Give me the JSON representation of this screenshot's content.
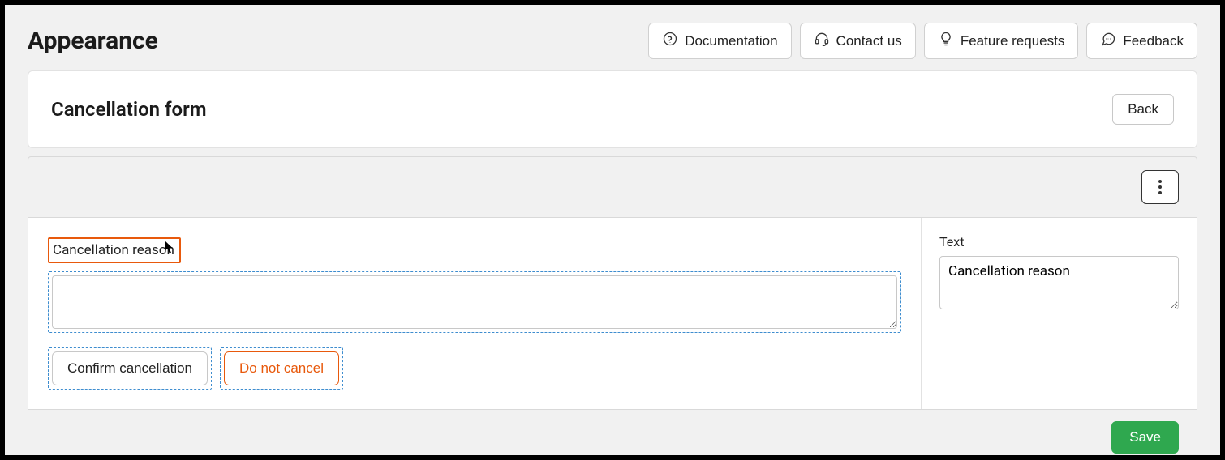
{
  "page": {
    "title": "Appearance"
  },
  "topbar": {
    "documentation": "Documentation",
    "contact": "Contact us",
    "feature_requests": "Feature requests",
    "feedback": "Feedback"
  },
  "panel": {
    "title": "Cancellation form",
    "back": "Back"
  },
  "canvas": {
    "label": "Cancellation reason",
    "textarea_value": "",
    "confirm": "Confirm cancellation",
    "do_not_cancel": "Do not cancel"
  },
  "inspector": {
    "label": "Text",
    "value": "Cancellation reason"
  },
  "footer": {
    "save": "Save"
  }
}
